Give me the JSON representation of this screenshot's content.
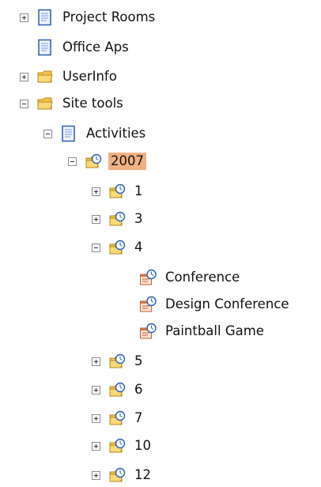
{
  "tree": {
    "project_rooms": "Project Rooms",
    "office_aps": "Office Aps",
    "userinfo": "UserInfo",
    "site_tools": "Site tools",
    "activities": "Activities",
    "year_2007": "2007",
    "m1": "1",
    "m3": "3",
    "m4": "4",
    "conference": "Conference",
    "design_conference": "Design Conference",
    "paintball_game": "Paintball Game",
    "m5": "5",
    "m6": "6",
    "m7": "7",
    "m10": "10",
    "m12": "12"
  },
  "colors": {
    "selected_bg": "#f2b182",
    "folder": "#f3c24a",
    "page_blue": "#2c5bb8"
  }
}
